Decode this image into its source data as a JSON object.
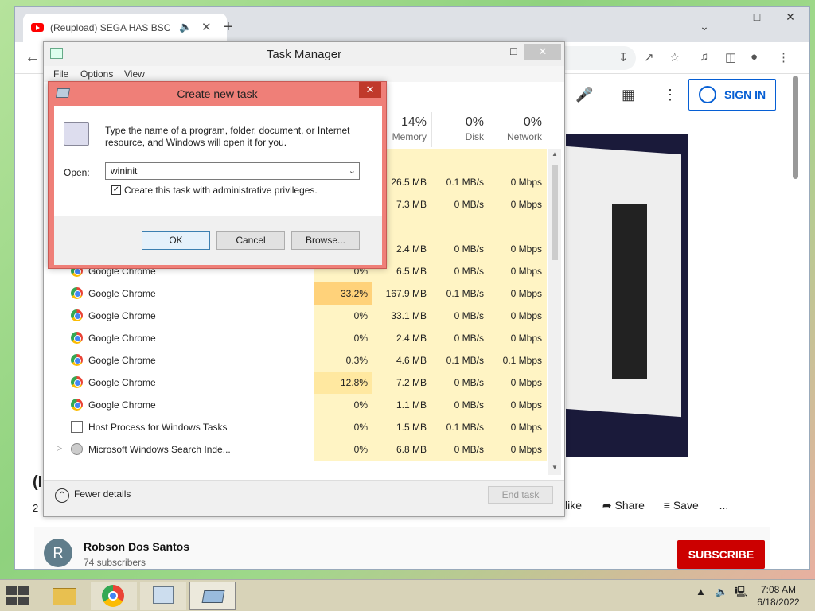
{
  "browser": {
    "tab_title": "(Reupload) SEGA HAS BSOD",
    "new_tab_symbol": "+",
    "window_controls": [
      "–",
      "□",
      "✕"
    ],
    "dropdown_symbol": "⌄"
  },
  "youtube": {
    "sign_in": "SIGN IN",
    "title_fragment": "(I",
    "views_fragment": "2",
    "actions": {
      "dislike": "slike",
      "share": "Share",
      "save": "Save",
      "more": "..."
    },
    "channel": {
      "avatar_letter": "R",
      "name": "Robson Dos Santos",
      "subscribers": "74 subscribers"
    },
    "subscribe": "SUBSCRIBE"
  },
  "task_manager": {
    "title": "Task Manager",
    "menu": [
      "File",
      "Options",
      "View"
    ],
    "columns": [
      {
        "pct": "14%",
        "label": "Memory"
      },
      {
        "pct": "0%",
        "label": "Disk"
      },
      {
        "pct": "0%",
        "label": "Network"
      }
    ],
    "partial_rows": [
      {
        "cpu": "",
        "mem": "",
        "disk": "",
        "net": ""
      },
      {
        "cpu": "",
        "mem": "26.5 MB",
        "disk": "0.1 MB/s",
        "net": "0 Mbps"
      },
      {
        "cpu": "",
        "mem": "7.3 MB",
        "disk": "0 MB/s",
        "net": "0 Mbps"
      },
      {
        "cpu": "",
        "mem": "",
        "disk": "",
        "net": ""
      },
      {
        "cpu": "",
        "mem": "2.4 MB",
        "disk": "0 MB/s",
        "net": "0 Mbps"
      }
    ],
    "rows": [
      {
        "name": "Google Chrome",
        "icon": "chrome-icon",
        "cpu": "0%",
        "mem": "6.5 MB",
        "disk": "0 MB/s",
        "net": "0 Mbps"
      },
      {
        "name": "Google Chrome",
        "icon": "chrome-icon",
        "cpu": "33.2%",
        "mem": "167.9 MB",
        "disk": "0.1 MB/s",
        "net": "0 Mbps"
      },
      {
        "name": "Google Chrome",
        "icon": "chrome-icon",
        "cpu": "0%",
        "mem": "33.1 MB",
        "disk": "0 MB/s",
        "net": "0 Mbps"
      },
      {
        "name": "Google Chrome",
        "icon": "chrome-icon",
        "cpu": "0%",
        "mem": "2.4 MB",
        "disk": "0 MB/s",
        "net": "0 Mbps"
      },
      {
        "name": "Google Chrome",
        "icon": "chrome-icon",
        "cpu": "0.3%",
        "mem": "4.6 MB",
        "disk": "0.1 MB/s",
        "net": "0.1 Mbps"
      },
      {
        "name": "Google Chrome",
        "icon": "chrome-icon",
        "cpu": "12.8%",
        "mem": "7.2 MB",
        "disk": "0 MB/s",
        "net": "0 Mbps"
      },
      {
        "name": "Google Chrome",
        "icon": "chrome-icon",
        "cpu": "0%",
        "mem": "1.1 MB",
        "disk": "0 MB/s",
        "net": "0 Mbps"
      },
      {
        "name": "Host Process for Windows Tasks",
        "icon": "host-process-icon",
        "cpu": "0%",
        "mem": "1.5 MB",
        "disk": "0.1 MB/s",
        "net": "0 Mbps"
      },
      {
        "name": "Microsoft Windows Search Inde...",
        "icon": "search-indexer-icon",
        "cpu": "0%",
        "mem": "6.8 MB",
        "disk": "0 MB/s",
        "net": "0 Mbps",
        "expandable": true
      }
    ],
    "fewer_details": "Fewer details",
    "end_task": "End task",
    "colors": {
      "heat_low": "#fff4c4",
      "heat_mid": "#ffe8a0",
      "heat_high": "#ffd27a"
    }
  },
  "dialog": {
    "title": "Create new task",
    "description": "Type the name of a program, folder, document, or Internet resource, and Windows will open it for you.",
    "open_label": "Open:",
    "open_value": "wininit",
    "admin_label": "Create this task with administrative privileges.",
    "admin_checked": true,
    "ok": "OK",
    "cancel": "Cancel",
    "browse": "Browse..."
  },
  "taskbar": {
    "time": "7:08 AM",
    "date": "6/18/2022"
  }
}
